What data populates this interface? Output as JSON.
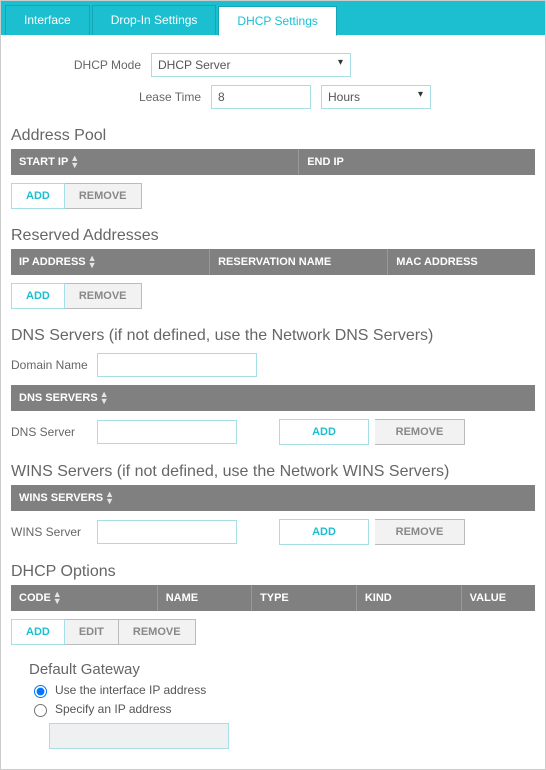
{
  "tabs": {
    "interface": "Interface",
    "dropin": "Drop-In Settings",
    "dhcp": "DHCP Settings"
  },
  "dhcp_mode": {
    "label": "DHCP Mode",
    "value": "DHCP Server"
  },
  "lease_time": {
    "label": "Lease Time",
    "value": "8",
    "unit": "Hours"
  },
  "address_pool": {
    "title": "Address Pool",
    "cols": {
      "start": "START IP",
      "end": "END IP"
    },
    "add": "ADD",
    "remove": "REMOVE"
  },
  "reserved": {
    "title": "Reserved Addresses",
    "cols": {
      "ip": "IP ADDRESS",
      "name": "RESERVATION NAME",
      "mac": "MAC ADDRESS"
    },
    "add": "ADD",
    "remove": "REMOVE"
  },
  "dns": {
    "title": "DNS Servers (if not defined, use the Network DNS Servers)",
    "domain_label": "Domain Name",
    "header": "DNS SERVERS",
    "server_label": "DNS Server",
    "add": "ADD",
    "remove": "REMOVE"
  },
  "wins": {
    "title": "WINS Servers (if not defined, use the Network WINS Servers)",
    "header": "WINS SERVERS",
    "server_label": "WINS Server",
    "add": "ADD",
    "remove": "REMOVE"
  },
  "options": {
    "title": "DHCP Options",
    "cols": {
      "code": "CODE",
      "name": "NAME",
      "type": "TYPE",
      "kind": "KIND",
      "value": "VALUE"
    },
    "add": "ADD",
    "edit": "EDIT",
    "remove": "REMOVE"
  },
  "gateway": {
    "title": "Default Gateway",
    "use_iface": "Use the interface IP address",
    "specify": "Specify an IP address"
  }
}
